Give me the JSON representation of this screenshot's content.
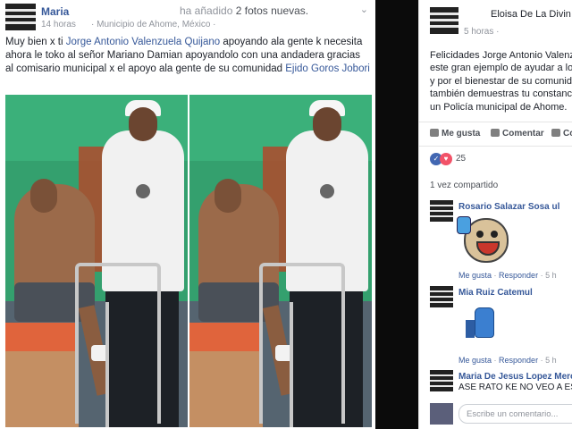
{
  "left_post": {
    "author": "Maria",
    "action_prefix": "ha añadido",
    "action_count": "2 fotos nuevas.",
    "time": "14 horas",
    "location": "· Municipio de Ahome, México ·",
    "text_1": "Muy bien x ti ",
    "mention_1": "Jorge Antonio Valenzuela Quijano",
    "text_2": " apoyando ala gente k necesita ahora le toko al señor Mariano Damian apoyandolo con una andadera gracias al comisario municipal x el apoyo ala gente de su comunidad ",
    "mention_2": "Ejido Goros Jobori",
    "chevron": "⌄"
  },
  "right_post": {
    "author_partial": "Eloisa De La Divin",
    "time": "5 horas ·",
    "lines": [
      "Felicidades Jorge Antonio Valenzu",
      "este gran ejemplo de ayudar a los",
      "y por el bienestar de su comunida",
      "también demuestras tu constancia",
      "un Policía municipal de Ahome."
    ],
    "like_label": "Me gusta",
    "comment_label": "Comentar",
    "share_label": "Co",
    "reaction_count": "25",
    "shared_count": "1 vez compartido",
    "comments": [
      {
        "name": "Rosario Salazar Sosa ul",
        "meta_like": "Me gusta",
        "meta_reply": "Responder",
        "meta_time": "· 5 h"
      },
      {
        "name": "Mia Ruiz Catemul",
        "meta_like": "Me gusta",
        "meta_reply": "Responder",
        "meta_time": "· 5 h"
      },
      {
        "name": "Maria De Jesus Lopez Mercedes",
        "reply_text": "ASE RATO KE NO VEO A ESE"
      }
    ],
    "composer_placeholder": "Escribe un comentario..."
  },
  "icons": {
    "like_reaction": "like-icon",
    "love_reaction": "heart-icon"
  },
  "colors": {
    "link": "#365899",
    "like": "#4267b2",
    "love": "#f25268",
    "divider": "#0b0b0b"
  }
}
